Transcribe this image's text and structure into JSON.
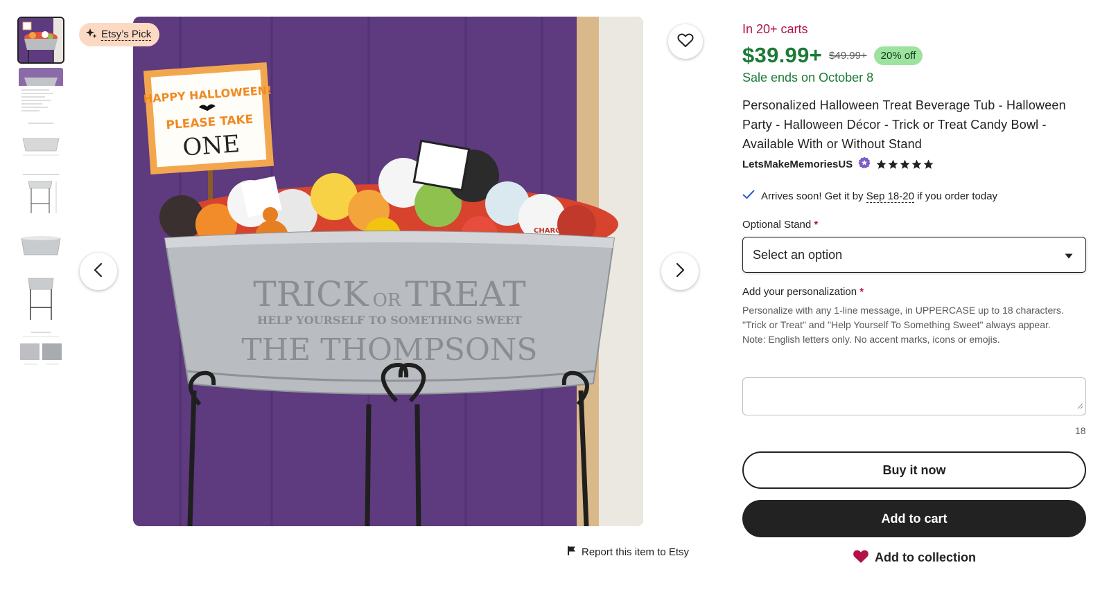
{
  "badge": {
    "label": "Etsy’s Pick",
    "icon": "sparkle-icon"
  },
  "image": {
    "sign_line1": "HAPPY HALLOWEEN!",
    "sign_line2": "PLEASE TAKE",
    "sign_line3": "ONE",
    "tub_line1": "TRICK",
    "tub_or": "OR",
    "tub_line1b": "TREAT",
    "tub_line2": "HELP YOURSELF TO SOMETHING SWEET",
    "tub_line3": "THE THOMPSONS",
    "candy_label": "CHARGE",
    "colors": {
      "wall": "#5e3a7e",
      "tub": "#b9bcc0"
    }
  },
  "report": {
    "label": "Report this item to Etsy",
    "icon": "flag-icon"
  },
  "product": {
    "in_carts": "In 20+ carts",
    "price": "$39.99+",
    "original_price": "$49.99+",
    "discount": "20% off",
    "sale_ends": "Sale ends on October 8",
    "title": "Personalized Halloween Treat Beverage Tub - Halloween Party - Halloween Décor - Trick or Treat Candy Bowl - Available With or Without Stand",
    "shop_name": "LetsMakeMemoriesUS",
    "rating": 5,
    "arrives_prefix": "Arrives soon! Get it by",
    "arrives_date": "Sep 18-20",
    "arrives_suffix": "if you order today"
  },
  "options": {
    "stand_label": "Optional Stand",
    "required_mark": "*",
    "stand_value": "Select an option",
    "personalization_label": "Add your personalization",
    "help_line1": "Personalize with any 1-line message, in UPPERCASE up to 18 characters.",
    "help_line2": "\"Trick or Treat\" and \"Help Yourself To Something Sweet\" always appear.",
    "help_line3": "Note: English letters only. No accent marks, icons or emojis.",
    "char_count": "18"
  },
  "actions": {
    "buy_now": "Buy it now",
    "add_to_cart": "Add to cart",
    "add_to_collection": "Add to collection"
  },
  "colors": {
    "sale_green": "#1c7a36",
    "carts_red": "#b3114a",
    "badge_peach": "#fcd9c3",
    "discount_green": "#9ee2a0"
  }
}
